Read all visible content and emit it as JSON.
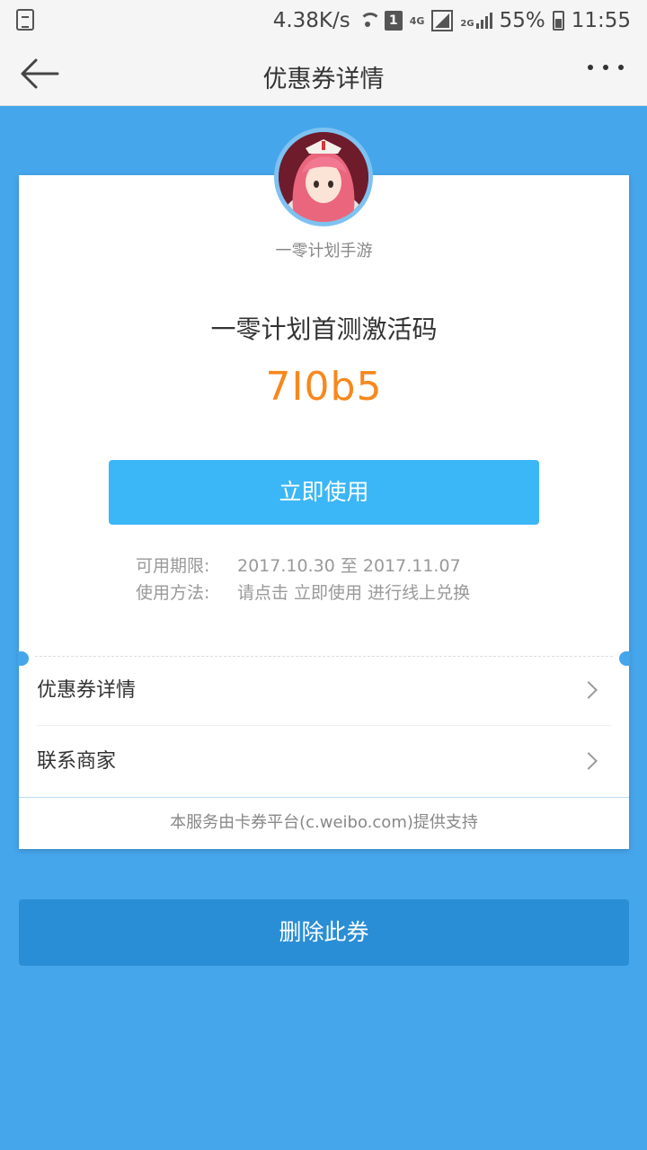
{
  "status_bar": {
    "network_speed": "4.38K/s",
    "sim": "1",
    "network_4g": "4G",
    "network_2g": "2G",
    "battery": "55%",
    "time": "11:55"
  },
  "nav": {
    "title": "优惠券详情"
  },
  "coupon": {
    "merchant_name": "一零计划手游",
    "title": "一零计划首测激活码",
    "code": "7I0b5",
    "use_label": "立即使用",
    "validity_label": "可用期限:",
    "validity_value": "2017.10.30 至 2017.11.07",
    "method_label": "使用方法:",
    "method_value": "请点击 立即使用 进行线上兑换"
  },
  "menu": {
    "details_label": "优惠券详情",
    "contact_label": "联系商家"
  },
  "footer_note": "本服务由卡券平台(c.weibo.com)提供支持",
  "delete_label": "删除此券",
  "colors": {
    "background": "#46a6eb",
    "primary_button": "#3bb7f7",
    "delete_button": "#2a8ed6",
    "code": "#f7881d"
  }
}
